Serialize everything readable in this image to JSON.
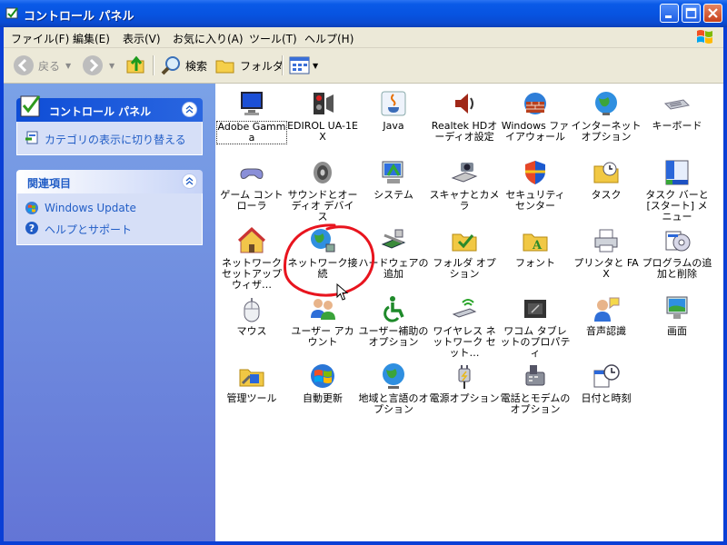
{
  "window": {
    "title": "コントロール パネル"
  },
  "menu": [
    "ファイル(F)",
    "編集(E)",
    "表示(V)",
    "お気に入り(A)",
    "ツール(T)",
    "ヘルプ(H)"
  ],
  "toolbar": {
    "back": "戻る",
    "search": "検索",
    "folders": "フォルダ"
  },
  "taskpane": {
    "control_panel_title": "コントロール パネル",
    "switch_category_link": "カテゴリの表示に切り替える",
    "related_title": "関連項目",
    "related_links": [
      "Windows Update",
      "ヘルプとサポート"
    ]
  },
  "items": [
    "Adobe Gamma",
    "EDIROL UA-1EX",
    "Java",
    "Realtek HDオーディオ設定",
    "Windows ファイアウォール",
    "インターネット オプション",
    "キーボード",
    "ゲーム コントローラ",
    "サウンドとオーディオ デバイス",
    "システム",
    "スキャナとカメラ",
    "セキュリティ センター",
    "タスク",
    "タスク バーと [スタート] メニュー",
    "ネットワーク セットアップ ウィザ…",
    "ネットワーク接続",
    "ハードウェアの追加",
    "フォルダ オプション",
    "フォント",
    "プリンタと FAX",
    "プログラムの追加と削除",
    "マウス",
    "ユーザー アカウント",
    "ユーザー補助のオプション",
    "ワイヤレス ネットワーク セット…",
    "ワコム タブレットのプロパティ",
    "音声認識",
    "画面",
    "管理ツール",
    "自動更新",
    "地域と言語のオプション",
    "電源オプション",
    "電話とモデムのオプション",
    "日付と時刻"
  ],
  "colors": {
    "titlebar": "#0753e0",
    "taskpane_top": "#7ba2e7",
    "link": "#215dc6",
    "annotation": "#e8141e"
  }
}
